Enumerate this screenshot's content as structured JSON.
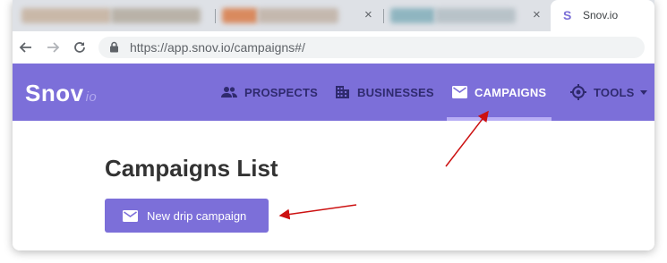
{
  "browser": {
    "active_tab_title": "Snov.io",
    "active_tab_favicon": "S",
    "close_symbol": "×",
    "url": "https://app.snov.io/campaigns#/"
  },
  "app": {
    "logo_main": "Snov",
    "logo_suffix": "io",
    "nav": [
      {
        "label": "PROSPECTS",
        "icon": "people-icon"
      },
      {
        "label": "BUSINESSES",
        "icon": "building-icon"
      },
      {
        "label": "CAMPAIGNS",
        "icon": "mail-icon",
        "active": true
      },
      {
        "label": "TOOLS",
        "icon": "target-icon",
        "has_dropdown": true
      }
    ],
    "colors": {
      "nav_bg": "#7c6fd9",
      "nav_text": "#2f2a6e",
      "arrow": "#cc1111"
    }
  },
  "page": {
    "title": "Campaigns List",
    "new_button_label": "New drip campaign"
  }
}
